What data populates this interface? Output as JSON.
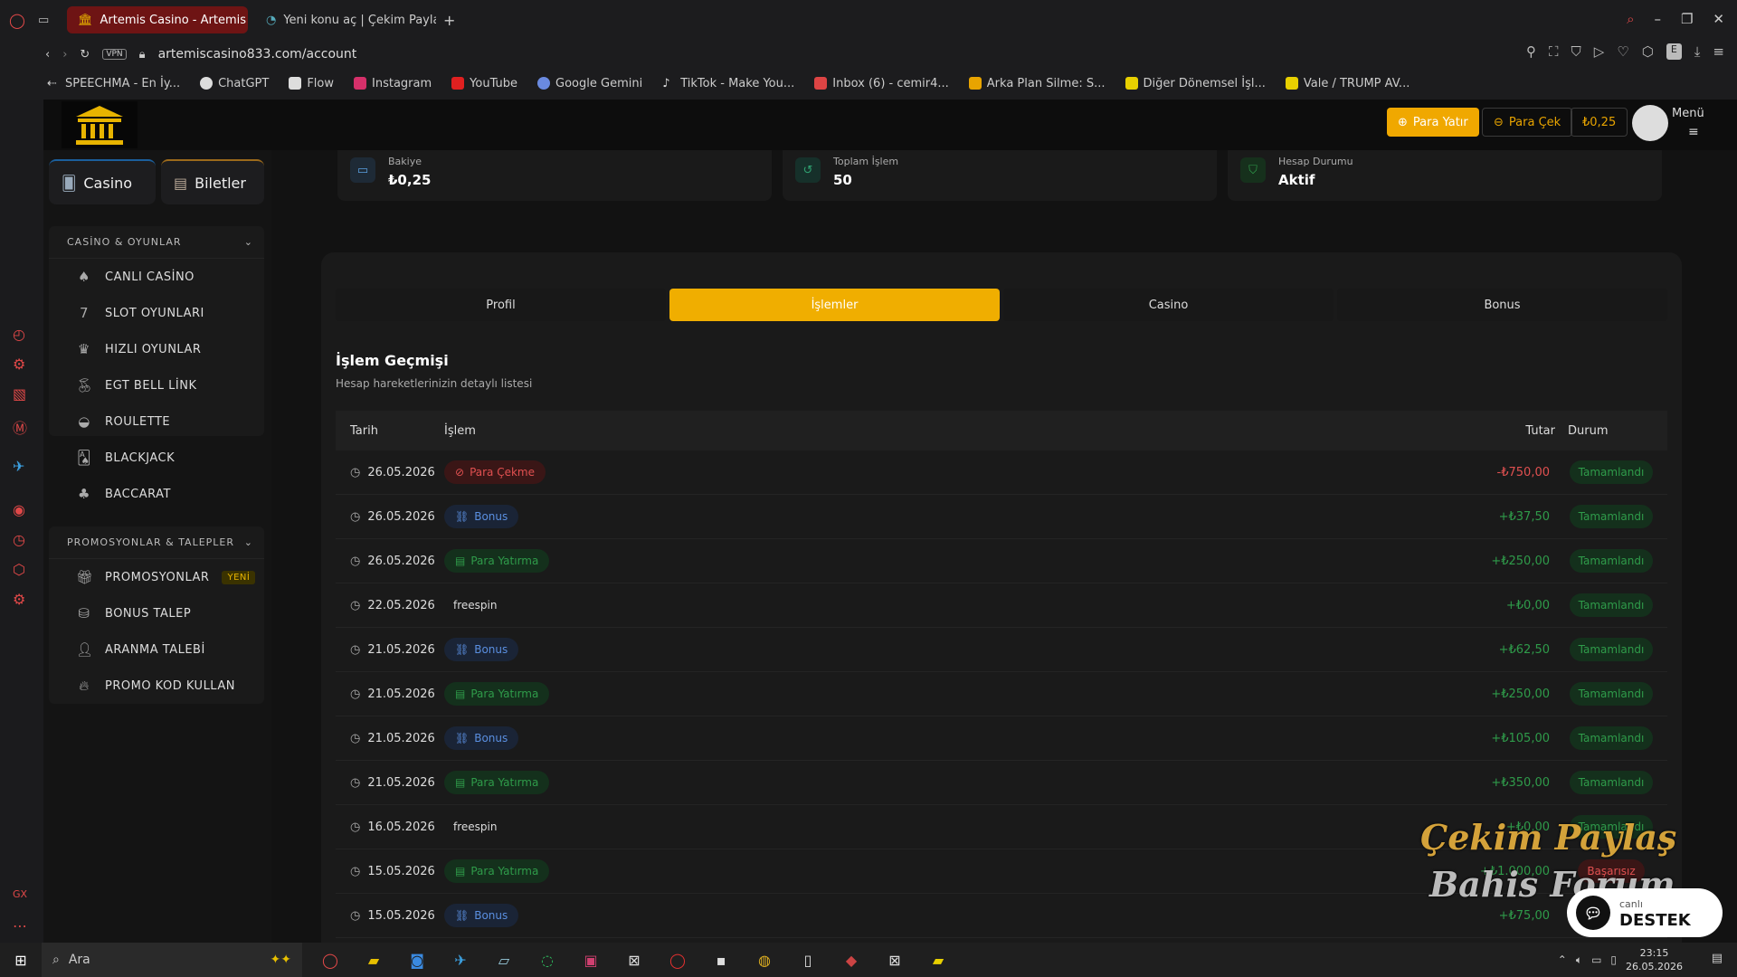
{
  "browser": {
    "tabs": [
      {
        "label": "Artemis Casino - Artemis C",
        "active": true
      },
      {
        "label": "Yeni konu aç | Çekim Payla",
        "active": false
      }
    ],
    "url": "artemiscasino833.com/account",
    "vpn_label": "VPN",
    "profile_letter": "E",
    "bookmarks": [
      "SPEECHMA - En İy...",
      "ChatGPT",
      "Flow",
      "Instagram",
      "YouTube",
      "Google Gemini",
      "TikTok - Make You...",
      "Inbox (6) - cemir4...",
      "Arka Plan Silme: S...",
      "Diğer Dönemsel İşl...",
      "Vale / TRUMP AV..."
    ]
  },
  "header": {
    "deposit_label": "Para Yatır",
    "withdraw_label": "Para Çek",
    "balance": "₺0,25",
    "menu_label": "Menü",
    "accent": "#f0ae00"
  },
  "nav": {
    "casino_label": "Casino",
    "biletler_label": "Biletler",
    "group1_title": "CASİNO & OYUNLAR",
    "group1_items": [
      "CANLI CASİNO",
      "SLOT OYUNLARI",
      "HIZLI OYUNLAR",
      "EGT BELL LİNK",
      "ROULETTE",
      "BLACKJACK",
      "BACCARAT"
    ],
    "group2_title": "PROMOSYONLAR & TALEPLER",
    "group2_items": [
      "PROMOSYONLAR",
      "BONUS TALEP",
      "ARANMA TALEBİ",
      "PROMO KOD KULLAN"
    ],
    "new_badge": "YENİ"
  },
  "stats": {
    "balance_label": "Bakiye",
    "balance_value": "₺0,25",
    "total_label": "Toplam İşlem",
    "total_value": "50",
    "status_label": "Hesap Durumu",
    "status_value": "Aktif"
  },
  "tabs": [
    "Profil",
    "İşlemler",
    "Casino",
    "Bonus"
  ],
  "section": {
    "title": "İşlem Geçmişi",
    "subtitle": "Hesap hareketlerinizin detaylı listesi"
  },
  "table": {
    "headers": {
      "date": "Tarih",
      "op": "İşlem",
      "amount": "Tutar",
      "status": "Durum"
    },
    "rows": [
      {
        "date": "26.05.2026",
        "op": "Para Çekme",
        "type": "red",
        "amount": "-₺750,00",
        "status": "Tamamlandı"
      },
      {
        "date": "26.05.2026",
        "op": "Bonus",
        "type": "blue",
        "amount": "+₺37,50",
        "status": "Tamamlandı"
      },
      {
        "date": "26.05.2026",
        "op": "Para Yatırma",
        "type": "green",
        "amount": "+₺250,00",
        "status": "Tamamlandı"
      },
      {
        "date": "22.05.2026",
        "op": "freespin",
        "type": "plain",
        "amount": "+₺0,00",
        "status": "Tamamlandı"
      },
      {
        "date": "21.05.2026",
        "op": "Bonus",
        "type": "blue",
        "amount": "+₺62,50",
        "status": "Tamamlandı"
      },
      {
        "date": "21.05.2026",
        "op": "Para Yatırma",
        "type": "green",
        "amount": "+₺250,00",
        "status": "Tamamlandı"
      },
      {
        "date": "21.05.2026",
        "op": "Bonus",
        "type": "blue",
        "amount": "+₺105,00",
        "status": "Tamamlandı"
      },
      {
        "date": "21.05.2026",
        "op": "Para Yatırma",
        "type": "green",
        "amount": "+₺350,00",
        "status": "Tamamlandı"
      },
      {
        "date": "16.05.2026",
        "op": "freespin",
        "type": "plain",
        "amount": "+₺0,00",
        "status": "Tamamlandı"
      },
      {
        "date": "15.05.2026",
        "op": "Para Yatırma",
        "type": "green",
        "amount": "+₺1.000,00",
        "status": "Başarısız"
      },
      {
        "date": "15.05.2026",
        "op": "Bonus",
        "type": "blue",
        "amount": "+₺75,00",
        "status": "Tamamlandı"
      }
    ]
  },
  "watermark": {
    "line1": "Çekim Paylaş",
    "line2": "Bahis Forum"
  },
  "support": {
    "small": "canlı",
    "label": "DESTEK"
  },
  "taskbar": {
    "search": "Ara",
    "time": "23:15",
    "date": "26.05.2026"
  }
}
